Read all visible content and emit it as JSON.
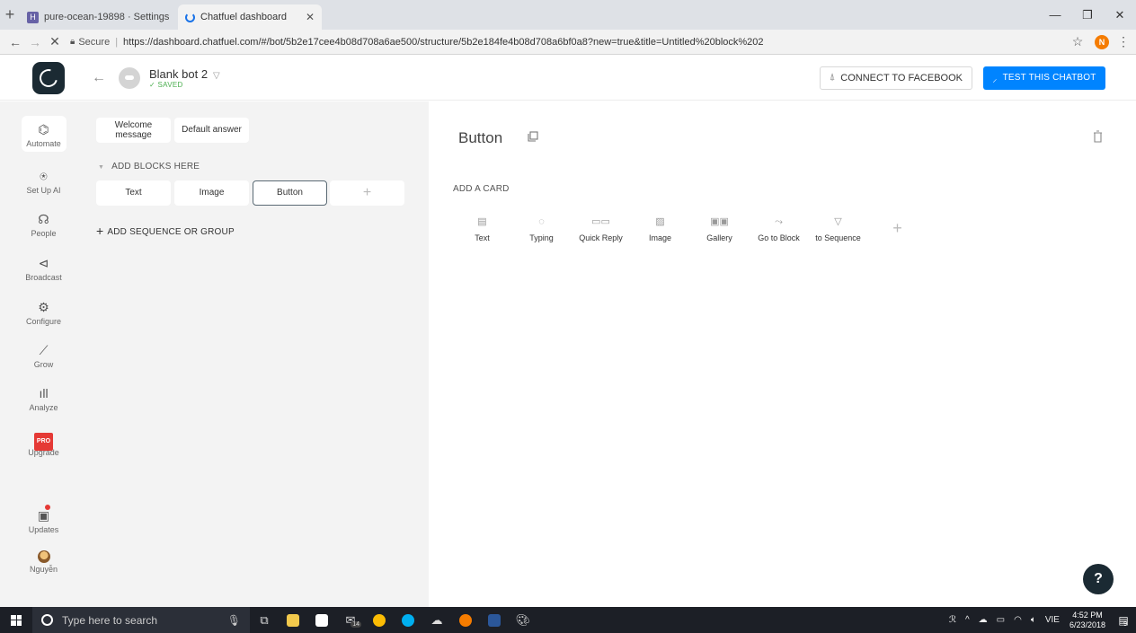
{
  "browser": {
    "tabs": [
      {
        "title": "pure-ocean-19898 · Settings",
        "active": false
      },
      {
        "title": "Chatfuel dashboard",
        "active": true
      }
    ],
    "url": "https://dashboard.chatfuel.com/#/bot/5b2e17cee4b08d708a6ae500/structure/5b2e184fe4b08d708a6bf0a8?new=true&title=Untitled%20block%202",
    "secure_label": "Secure",
    "profile_initial": "N"
  },
  "header": {
    "bot_name": "Blank bot 2",
    "saved_label": "✓ SAVED",
    "connect_label": "CONNECT TO FACEBOOK",
    "test_label": "TEST THIS CHATBOT"
  },
  "nav": {
    "automate": "Automate",
    "setup_ai": "Set Up AI",
    "people": "People",
    "broadcast": "Broadcast",
    "configure": "Configure",
    "grow": "Grow",
    "analyze": "Analyze",
    "pro_badge": "PRO",
    "upgrade": "Upgrade",
    "updates": "Updates",
    "user": "Nguyễn"
  },
  "blocks": {
    "welcome": "Welcome message",
    "default_answer": "Default answer",
    "add_blocks_label": "ADD BLOCKS HERE",
    "items": [
      "Text",
      "Image",
      "Button"
    ],
    "add_plus": "+",
    "add_sequence": "ADD SEQUENCE OR GROUP"
  },
  "editor": {
    "block_title": "Button",
    "add_card_label": "ADD A CARD",
    "cards": [
      "Text",
      "Typing",
      "Quick Reply",
      "Image",
      "Gallery",
      "Go to Block",
      "to Sequence"
    ],
    "add_plus": "+"
  },
  "taskbar": {
    "search_placeholder": "Type here to search",
    "lang": "VIE",
    "time": "4:52 PM",
    "date": "6/23/2018",
    "mail_count": "14",
    "notif_count": "9"
  }
}
